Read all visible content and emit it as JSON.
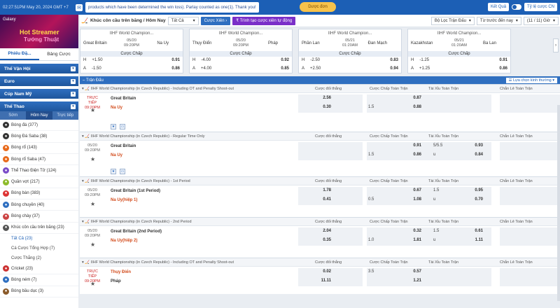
{
  "topbar": {
    "time": "02:27:51PM May 20, 2024 GMT +7",
    "mail_icon": "mail-icon",
    "notice": "products which have been determined the win loss). Parlay counted as one(1). Thank you!",
    "center_btn": "Dược đơn",
    "quick_results": "Kết Quả",
    "odds_type": "Tỷ lệ cược CN"
  },
  "sidebar": {
    "banner": {
      "brand": "Galaxy",
      "line1": "Hot Streamer",
      "line2": "Tướng Thuật"
    },
    "tabs": [
      "Phiếu Đặ...",
      "Bảng Cược"
    ],
    "categories": [
      {
        "label": "Thể Vận Hội"
      },
      {
        "label": "Euro"
      },
      {
        "label": "Cúp Nam Mỹ"
      },
      {
        "label": "Thể Thao"
      }
    ],
    "subtabs": [
      "Sớm",
      "Hôm Nay",
      "Trực tiếp"
    ],
    "sports": [
      {
        "label": "Bóng đá (377)",
        "icon": "soccer-ball-icon",
        "color": "#333"
      },
      {
        "label": "Bóng Đá Saba (38)",
        "icon": "soccer-ball-icon",
        "color": "#333"
      },
      {
        "label": "Bóng rổ (143)",
        "icon": "basketball-icon",
        "color": "#e86a1c"
      },
      {
        "label": "Bóng rổ Saba (47)",
        "icon": "basketball-icon",
        "color": "#e86a1c"
      },
      {
        "label": "Thể Thao Điện Tử (124)",
        "icon": "esports-icon",
        "color": "#7a4cc8"
      },
      {
        "label": "Quần vợt (217)",
        "icon": "tennis-ball-icon",
        "color": "#8dbb2a"
      },
      {
        "label": "Bóng bàn (383)",
        "icon": "table-tennis-icon",
        "color": "#d33"
      },
      {
        "label": "Bóng chuyền (40)",
        "icon": "volleyball-icon",
        "color": "#2f6fc0"
      },
      {
        "label": "Bóng chày (37)",
        "icon": "baseball-icon",
        "color": "#c44"
      },
      {
        "label": "Khúc côn cầu trên băng (23)",
        "icon": "ice-hockey-icon",
        "color": "#555"
      }
    ],
    "subs": [
      "Tất Cả (23)",
      "Cá Cược Tổng Hợp (7)",
      "Cược Thắng (2)"
    ],
    "sports_after": [
      {
        "label": "Cricket (23)",
        "icon": "cricket-icon",
        "color": "#c33"
      },
      {
        "label": "Bóng ném (7)",
        "icon": "handball-icon",
        "color": "#2f6fc0"
      },
      {
        "label": "Bóng bầu dục (3)",
        "icon": "rugby-icon",
        "color": "#8a5a2a"
      }
    ]
  },
  "filter": {
    "title": "Khúc côn cầu trên băng / Hôm Nay",
    "all": "Tất Cả",
    "parlay": "Cược Xiên",
    "parlay_auto": "Trình tạo cược xiên tự động",
    "league_filter": "Bộ Lọc Trận Đấu",
    "sort": "Từ trước đến nay",
    "paging": "(11 / 11) Giờ"
  },
  "cards": [
    {
      "league": "IIHF World Champion...",
      "home": "Great Britain",
      "away": "Na Uy",
      "date": "05/20",
      "time": "09:20PM",
      "market": "Cược Chấp",
      "r1": [
        "H",
        "+1.50",
        "0.91"
      ],
      "r2": [
        "A",
        "-1.50",
        "0.86"
      ]
    },
    {
      "league": "IIHF World Champion...",
      "home": "Thụy Điển",
      "away": "Pháp",
      "date": "05/20",
      "time": "09:20PM",
      "market": "Cược Chấp",
      "r1": [
        "H",
        "-4.00",
        "0.92"
      ],
      "r2": [
        "A",
        "+4.00",
        "0.85"
      ]
    },
    {
      "league": "IIHF World Champion...",
      "home": "Phần Lan",
      "away": "Đan Mạch",
      "date": "05/21",
      "time": "01:20AM",
      "market": "Cược Chấp",
      "r1": [
        "H",
        "-2.50",
        "0.83"
      ],
      "r2": [
        "A",
        "+2.50",
        "0.94"
      ]
    },
    {
      "league": "IIHF World Champion...",
      "home": "Kazakhstan",
      "away": "Ba Lan",
      "date": "05/21",
      "time": "01:20AM",
      "market": "Cược Chấp",
      "r1": [
        "H",
        "-1.25",
        "0.91"
      ],
      "r2": [
        "A",
        "+1.25",
        "0.86"
      ]
    }
  ],
  "bar": {
    "label": "Trận Đấu",
    "market_select": "Lựa chọn kình thường"
  },
  "columns": [
    "Cược đối thắng",
    "Cược Chấp Toàn Trận",
    "Tài Xỉu Toàn Trận",
    "Chẵn Lẻ Toàn Trận"
  ],
  "leagues": [
    {
      "name": "IIHF World Championship (in Czech Republic) - Including OT and Penalty Shoot-out",
      "h": 56,
      "time": [
        "TRỰC TIẾP",
        "09:20PM"
      ],
      "live": true,
      "home": "Great Britain",
      "away": "Na Uy",
      "home_red": false,
      "away_red": true,
      "rows": [
        [
          "2.56",
          "",
          "0.87",
          "",
          ""
        ],
        [
          "0.30",
          "1.5",
          "0.88",
          "",
          ""
        ]
      ],
      "icons": true
    },
    {
      "name": "IIHF World Championship (in Czech Republic) - Regular Time Only",
      "h": 52,
      "time": [
        "05/20",
        "09:20PM"
      ],
      "live": false,
      "home": "Great Britain",
      "away": "Na Uy",
      "home_red": false,
      "away_red": true,
      "rows": [
        [
          "",
          "",
          "0.91",
          "5/5.5",
          "0.93"
        ],
        [
          "",
          "1.5",
          "0.86",
          "u",
          "0.84"
        ]
      ],
      "icons": true
    },
    {
      "name": "IIHF World Championship (in Czech Republic) - 1st Period",
      "h": 46,
      "time": [
        "05/20",
        "09:20PM"
      ],
      "live": false,
      "home": "Great Britain (1st Period)",
      "away": "Na Uy(hiệp 1)",
      "home_red": false,
      "away_red": true,
      "rows": [
        [
          "1.78",
          "",
          "0.67",
          "1.5",
          "0.95"
        ],
        [
          "0.41",
          "0.5",
          "1.08",
          "u",
          "0.70"
        ]
      ],
      "icons": false
    },
    {
      "name": "IIHF World Championship (in Czech Republic) - 2nd Period",
      "h": 46,
      "time": [
        "05/20",
        "09:20PM"
      ],
      "live": false,
      "home": "Great Britain (2nd Period)",
      "away": "Na Uy(hiệp 2)",
      "home_red": false,
      "away_red": true,
      "rows": [
        [
          "2.04",
          "",
          "0.32",
          "1.5",
          "0.61"
        ],
        [
          "0.35",
          "1.0",
          "1.81",
          "u",
          "1.11"
        ]
      ],
      "icons": false
    },
    {
      "name": "IIHF World Championship (in Czech Republic) - Including OT and Penalty Shoot-out",
      "h": 40,
      "time": [
        "TRỰC TIẾP",
        "09:20PM"
      ],
      "live": true,
      "home": "Thụy Điển",
      "away": "Pháp",
      "home_red": true,
      "away_red": false,
      "rows": [
        [
          "0.02",
          "3.5",
          "0.57",
          "",
          ""
        ],
        [
          "11.11",
          "",
          "1.21",
          "",
          ""
        ]
      ],
      "icons": false
    }
  ]
}
